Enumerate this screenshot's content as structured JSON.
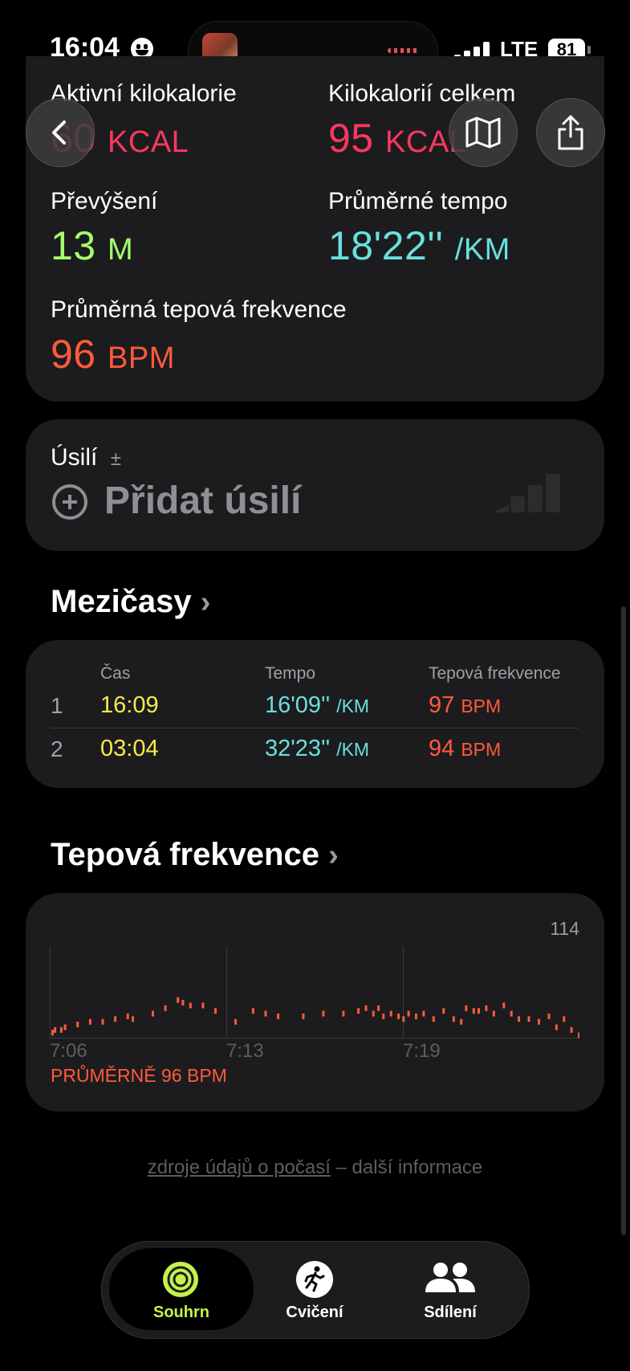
{
  "status": {
    "time": "16:04",
    "network": "LTE",
    "battery": "81"
  },
  "metrics": {
    "active_kcal": {
      "label": "Aktivní kilokalorie",
      "value": "60",
      "unit": "KCAL",
      "color": "#ff375f"
    },
    "total_kcal": {
      "label": "Kilokalorií celkem",
      "value": "95",
      "unit": "KCAL",
      "color": "#ff375f"
    },
    "elevation": {
      "label": "Převýšení",
      "value": "13",
      "unit": "M",
      "color": "#a6ff6e"
    },
    "avg_pace": {
      "label": "Průměrné tempo",
      "value": "18'22''",
      "unit": "/KM",
      "color": "#69e0e0"
    },
    "avg_hr": {
      "label": "Průměrná tepová frekvence",
      "value": "96",
      "unit": "BPM",
      "color": "#ff5a3c"
    }
  },
  "effort": {
    "label": "Úsilí",
    "plusminus": "±",
    "add_label": "Přidat úsilí"
  },
  "splits": {
    "title": "Mezičasy",
    "headers": [
      "Čas",
      "Tempo",
      "Tepová frekvence"
    ],
    "rows": [
      {
        "n": "1",
        "time": "16:09",
        "pace": "16'09''",
        "pace_unit": "/KM",
        "hr": "97",
        "hr_unit": "BPM"
      },
      {
        "n": "2",
        "time": "03:04",
        "pace": "32'23''",
        "pace_unit": "/KM",
        "hr": "94",
        "hr_unit": "BPM"
      }
    ]
  },
  "heart_rate": {
    "title": "Tepová frekvence",
    "max_label": "114",
    "x_labels": [
      "7:06",
      "7:13",
      "7:19"
    ],
    "average_label": "PRŮMĚRNĚ 96 BPM"
  },
  "chart_data": {
    "type": "scatter",
    "ylim": [
      80,
      114
    ],
    "x_ticks": [
      "7:06",
      "7:13",
      "7:19"
    ],
    "color": "#ff5a3c",
    "points": [
      [
        0.0,
        82
      ],
      [
        0.1,
        83
      ],
      [
        0.35,
        83
      ],
      [
        0.5,
        84
      ],
      [
        1.0,
        85
      ],
      [
        1.5,
        86
      ],
      [
        2.0,
        86
      ],
      [
        2.5,
        87
      ],
      [
        3.0,
        88
      ],
      [
        3.2,
        87
      ],
      [
        4.0,
        89
      ],
      [
        4.5,
        91
      ],
      [
        5.0,
        94
      ],
      [
        5.2,
        93
      ],
      [
        5.5,
        92
      ],
      [
        6.0,
        92
      ],
      [
        6.5,
        90
      ],
      [
        7.3,
        86
      ],
      [
        8.0,
        90
      ],
      [
        8.5,
        89
      ],
      [
        9.0,
        88
      ],
      [
        10.0,
        88
      ],
      [
        10.8,
        89
      ],
      [
        11.6,
        89
      ],
      [
        12.2,
        90
      ],
      [
        12.5,
        91
      ],
      [
        12.8,
        89
      ],
      [
        13.0,
        91
      ],
      [
        13.2,
        88
      ],
      [
        13.5,
        89
      ],
      [
        13.8,
        88
      ],
      [
        14.0,
        87
      ],
      [
        14.2,
        89
      ],
      [
        14.5,
        88
      ],
      [
        14.8,
        89
      ],
      [
        15.2,
        87
      ],
      [
        15.6,
        90
      ],
      [
        16.0,
        87
      ],
      [
        16.3,
        86
      ],
      [
        16.5,
        91
      ],
      [
        16.8,
        90
      ],
      [
        17.0,
        90
      ],
      [
        17.3,
        91
      ],
      [
        17.6,
        89
      ],
      [
        18.0,
        92
      ],
      [
        18.3,
        89
      ],
      [
        18.6,
        87
      ],
      [
        19.0,
        87
      ],
      [
        19.4,
        86
      ],
      [
        19.8,
        88
      ],
      [
        20.1,
        84
      ],
      [
        20.4,
        87
      ],
      [
        20.7,
        83
      ],
      [
        21.0,
        81
      ]
    ]
  },
  "footer": {
    "link": "zdroje údajů o počasí",
    "rest": " – další informace"
  },
  "tabs": [
    {
      "label": "Souhrn",
      "color": "#c4f24a"
    },
    {
      "label": "Cvičení",
      "color": "#ffffff"
    },
    {
      "label": "Sdílení",
      "color": "#ffffff"
    }
  ]
}
